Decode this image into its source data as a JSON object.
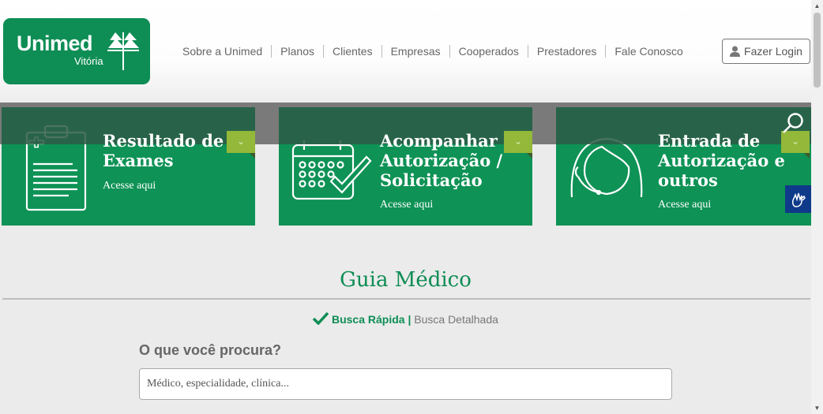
{
  "brand": {
    "name": "Unimed",
    "sub": "Vitória",
    "color": "#0e8d55"
  },
  "nav": {
    "items": [
      {
        "label": "Sobre a Unimed"
      },
      {
        "label": "Planos"
      },
      {
        "label": "Clientes"
      },
      {
        "label": "Empresas"
      },
      {
        "label": "Cooperados"
      },
      {
        "label": "Prestadores"
      },
      {
        "label": "Fale Conosco"
      }
    ],
    "login_label": "Fazer Login",
    "login_icon": "user-icon"
  },
  "cards": [
    {
      "title_line1": "Resultado de",
      "title_line2": "Exames",
      "title_line3": "",
      "link": "Acesse aqui",
      "icon": "clipboard-icon"
    },
    {
      "title_line1": "Acompanhar",
      "title_line2": "Autorização /",
      "title_line3": "Solicitação",
      "link": "Acesse aqui",
      "icon": "calendar-check-icon"
    },
    {
      "title_line1": "Entrada de",
      "title_line2": "Autorização e",
      "title_line3": "outros",
      "link": "Acesse aqui",
      "icon": "headset-person-icon"
    }
  ],
  "guide": {
    "title": "Guia Médico",
    "quick_search": "Busca Rápida",
    "separator": "|",
    "detailed_search": "Busca Detalhada",
    "question": "O que você procura?",
    "placeholder": "Médico, especialidade, clínica..."
  }
}
